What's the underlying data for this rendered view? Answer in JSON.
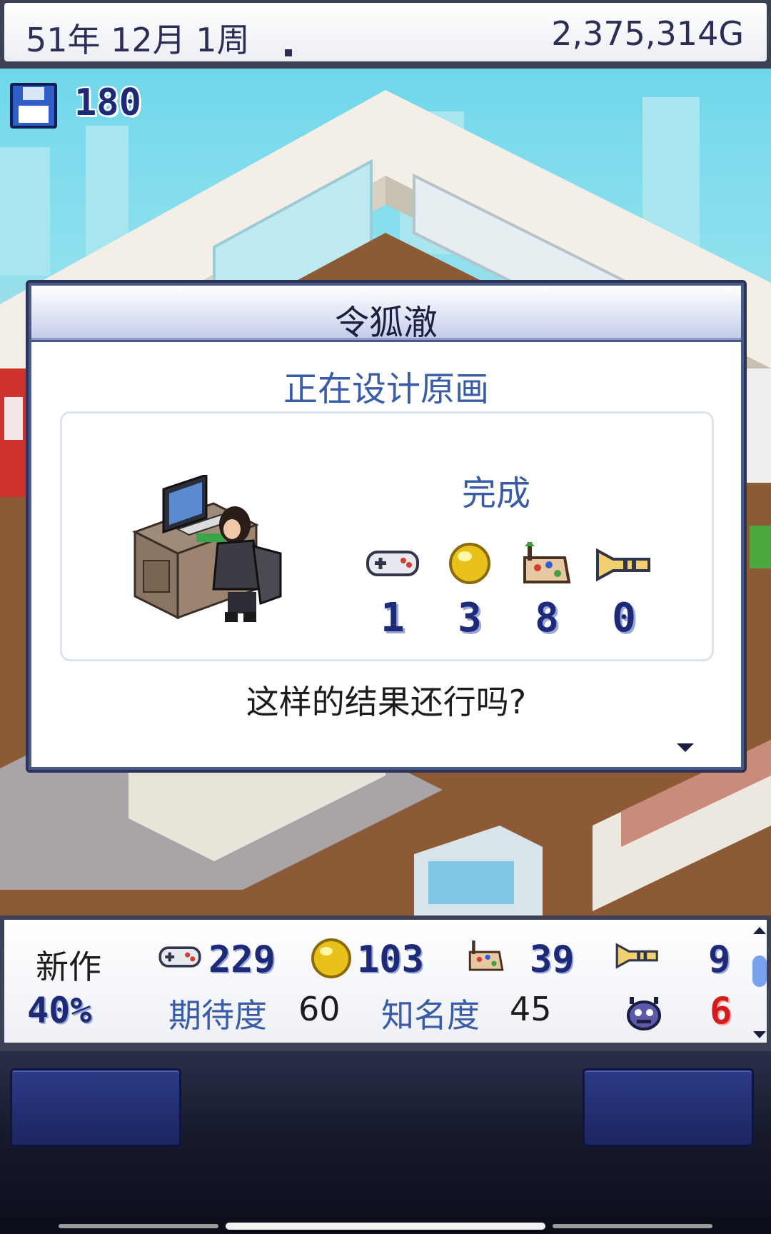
{
  "status_bar": {
    "date": "51年 12月 1周",
    "money": "2,375,314G"
  },
  "save": {
    "icon": "floppy-disk-icon",
    "count": "180"
  },
  "dialog": {
    "title": "令狐澈",
    "subtitle": "正在设计原画",
    "result_label": "完成",
    "stats": [
      {
        "icon": "gamepad-icon",
        "value": "1"
      },
      {
        "icon": "gold-orb-icon",
        "value": "3"
      },
      {
        "icon": "art-palette-icon",
        "value": "8"
      },
      {
        "icon": "trumpet-icon",
        "value": "0"
      }
    ],
    "question": "这样的结果还行吗?"
  },
  "project": {
    "label": "新作",
    "progress": "40%",
    "stats": [
      {
        "icon": "gamepad-icon",
        "value": "229"
      },
      {
        "icon": "gold-orb-icon",
        "value": "103"
      },
      {
        "icon": "art-palette-icon",
        "value": "39"
      },
      {
        "icon": "trumpet-icon",
        "value": "9"
      }
    ],
    "expectation_label": "期待度",
    "expectation_value": "60",
    "fame_label": "知名度",
    "fame_value": "45",
    "bug_icon": "bug-icon",
    "bugs": "6"
  },
  "colors": {
    "accent_blue": "#3a5ca8",
    "number_navy": "#1c2a78",
    "bug_red": "#d41c1c"
  }
}
